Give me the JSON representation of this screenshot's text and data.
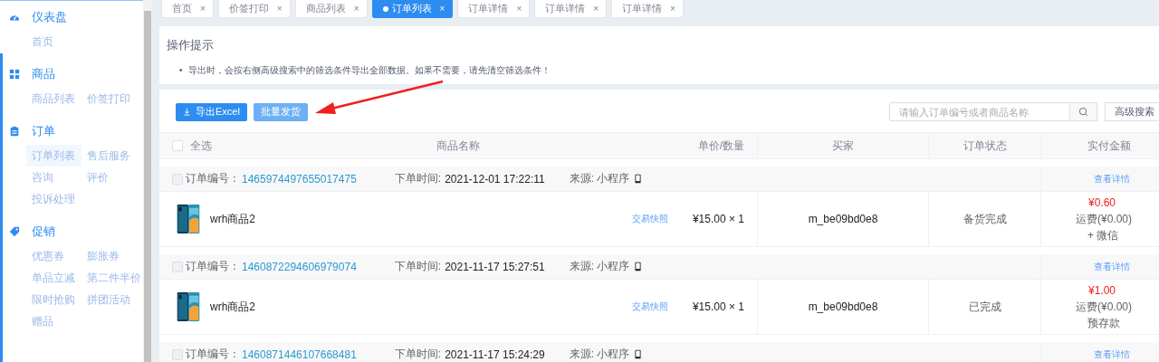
{
  "sidebar": {
    "sections": [
      {
        "title": "仪表盘",
        "items": [
          {
            "label": "首页",
            "selected": false
          }
        ]
      },
      {
        "title": "商品",
        "items": [
          {
            "label": "商品列表",
            "selected": false
          },
          {
            "label": "价签打印",
            "selected": false
          }
        ]
      },
      {
        "title": "订单",
        "items": [
          {
            "label": "订单列表",
            "selected": true
          },
          {
            "label": "售后服务",
            "selected": false
          },
          {
            "label": "咨询",
            "selected": false
          },
          {
            "label": "评价",
            "selected": false
          },
          {
            "label": "投诉处理",
            "selected": false
          }
        ]
      },
      {
        "title": "促销",
        "items": [
          {
            "label": "优惠券",
            "selected": false
          },
          {
            "label": "膨胀券",
            "selected": false
          },
          {
            "label": "单品立减",
            "selected": false
          },
          {
            "label": "第二件半价",
            "selected": false
          },
          {
            "label": "限时抢购",
            "selected": false
          },
          {
            "label": "拼团活动",
            "selected": false
          },
          {
            "label": "赠品",
            "selected": false
          }
        ]
      }
    ]
  },
  "tabs": [
    {
      "label": "首页",
      "close": "×",
      "selected": false
    },
    {
      "label": "价签打印",
      "close": "×",
      "selected": false
    },
    {
      "label": "商品列表",
      "close": "×",
      "selected": false
    },
    {
      "label": "订单列表",
      "close": "×",
      "selected": true
    },
    {
      "label": "订单详情",
      "close": "×",
      "selected": false
    },
    {
      "label": "订单详情",
      "close": "×",
      "selected": false
    },
    {
      "label": "订单详情",
      "close": "×",
      "selected": false
    }
  ],
  "notice": {
    "title": "操作提示",
    "bullets": [
      {
        "marker": "•",
        "text": "导出时，会按右侧高级搜索中的筛选条件导出全部数据。如果不需要，请先清空筛选条件！"
      }
    ]
  },
  "toolbar": {
    "buttons": [
      {
        "label": "导出Excel",
        "kind": "export",
        "disabled": false
      },
      {
        "label": "批量发货",
        "kind": "plain",
        "disabled": true
      }
    ],
    "search": {
      "placeholder": "请输入订单编号或者商品名称"
    },
    "advanced_search": "高级搜索"
  },
  "table": {
    "select_all": {
      "label": "全选",
      "checked": false
    },
    "columns": [
      "商品名称",
      "单价/数量",
      "买家",
      "订单状态",
      "实付金额"
    ],
    "orders": [
      {
        "checked": false,
        "order_no_label": "订单编号：",
        "order_no": "1465974497655017475",
        "time_label": "下单时间:",
        "time": "2021-12-01 17:22:11",
        "source_label": "来源: 小程序",
        "detail_link": "查看详情",
        "item": {
          "name": "wrh商品2",
          "snapshot": "交易快照",
          "price_qty": "¥15.00 × 1"
        },
        "buyer": "m_be09bd0e8",
        "status": "备货完成",
        "amount": "¥0.60",
        "shipping": "运费(¥0.00)",
        "payment": "+ 微信"
      },
      {
        "checked": false,
        "order_no_label": "订单编号：",
        "order_no": "1460872294606979074",
        "time_label": "下单时间:",
        "time": "2021-11-17 15:27:51",
        "source_label": "来源: 小程序",
        "detail_link": "查看详情",
        "item": {
          "name": "wrh商品2",
          "snapshot": "交易快照",
          "price_qty": "¥15.00 × 1"
        },
        "buyer": "m_be09bd0e8",
        "status": "已完成",
        "amount": "¥1.00",
        "shipping": "运费(¥0.00)",
        "payment": "预存款"
      },
      {
        "checked": false,
        "order_no_label": "订单编号：",
        "order_no": "1460871446107668481",
        "time_label": "下单时间:",
        "time": "2021-11-17 15:24:29",
        "source_label": "来源: 小程序",
        "detail_link": "查看详情"
      }
    ]
  }
}
